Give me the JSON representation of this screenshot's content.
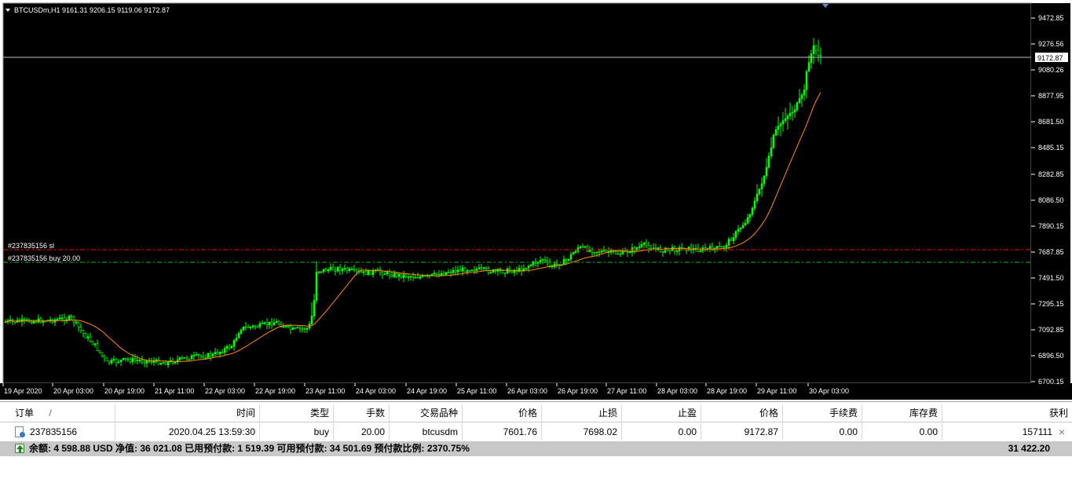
{
  "chart": {
    "symbol_info": "BTCUSDm,H1  9161.31 9206.15 9119.06 9172.87",
    "current_price_label": "9172.87",
    "price_axis": [
      "9472.85",
      "9276.56",
      "9080.26",
      "8877.95",
      "8681.50",
      "8485.15",
      "8282.85",
      "8086.50",
      "7890.15",
      "7687.85",
      "7491.50",
      "7295.15",
      "7092.85",
      "6896.50",
      "6700.15"
    ],
    "time_axis": [
      "19 Apr 2020",
      "20 Apr 03:00",
      "20 Apr 19:00",
      "21 Apr 11:00",
      "22 Apr 03:00",
      "22 Apr 19:00",
      "23 Apr 11:00",
      "24 Apr 03:00",
      "24 Apr 19:00",
      "25 Apr 11:00",
      "26 Apr 03:00",
      "26 Apr 19:00",
      "27 Apr 11:00",
      "28 Apr 03:00",
      "28 Apr 19:00",
      "29 Apr 11:00",
      "30 Apr 03:00"
    ],
    "sl_label": "#237835156 sl",
    "buy_label": "#237835156 buy 20.00",
    "colors": {
      "background": "#000000",
      "bull": "#00ff00",
      "ma": "#ff8c00",
      "sl_line": "#ff0000",
      "buy_line": "#00c000",
      "grid": "#ffffff"
    }
  },
  "terminal": {
    "headers": [
      "订单",
      "时间",
      "类型",
      "手数",
      "交易品种",
      "价格",
      "止损",
      "止盈",
      "价格",
      "手续费",
      "库存费",
      "获利"
    ],
    "sort_indicator": "/",
    "position": {
      "order": "237835156",
      "time": "2020.04.25 13:59:30",
      "type": "buy",
      "volume": "20.00",
      "symbol": "btcusdm",
      "open_price": "7601.76",
      "sl": "7698.02",
      "tp": "0.00",
      "current_price": "9172.87",
      "commission": "0.00",
      "swap": "0.00",
      "profit": "157111",
      "close": "×"
    },
    "summary": {
      "text": "余额: 4 598.88 USD  净值: 36 021.08  已用预付款: 1 519.39  可用预付款: 34 501.69  预付款比例: 2370.75%",
      "total_profit": "31 422.20"
    }
  }
}
